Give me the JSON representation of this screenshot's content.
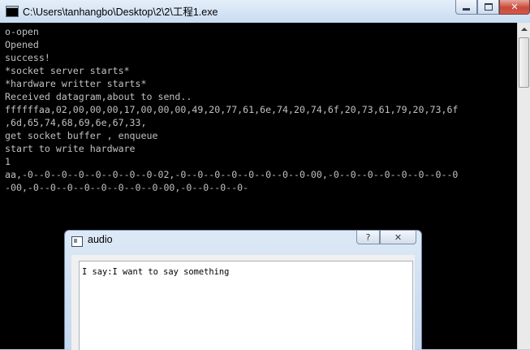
{
  "console_window": {
    "title": "C:\\Users\\tanhangbo\\Desktop\\2\\2\\工程1.exe",
    "caption": {
      "minimize": "",
      "maximize": "",
      "close": "✕"
    },
    "lines": [
      "o-open",
      "Opened",
      "success!",
      "*socket server starts*",
      "*hardware writter starts*",
      "Received datagram,about to send..",
      "ffffffaa,02,00,00,00,17,00,00,00,49,20,77,61,6e,74,20,74,6f,20,73,61,79,20,73,6f",
      ",6d,65,74,68,69,6e,67,33,",
      "get socket buffer , enqueue",
      "start to write hardware",
      "1",
      "aa,-0--0--0--0--0--0--0--0-02,-0--0--0--0--0--0--0--0-00,-0--0--0--0--0--0--0--0",
      "-00,-0--0--0--0--0--0--0--0-00,-0--0--0--0-"
    ]
  },
  "audio_window": {
    "title": "audio",
    "help_label": "?",
    "close_label": "✕",
    "text": "I say:I want to say something"
  }
}
